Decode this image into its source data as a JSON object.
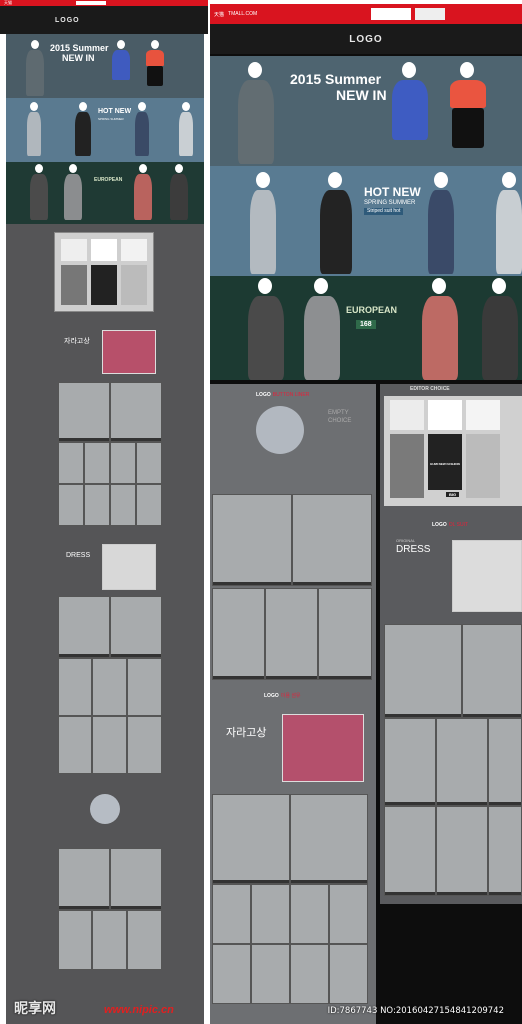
{
  "store": {
    "top_tmall": "天猫",
    "top_tmall_url": "TMALL.COM",
    "logo": "LOGO",
    "nav_items": [
      "",
      "",
      "",
      "",
      "",
      "",
      "",
      ""
    ]
  },
  "banners": {
    "summer_line1": "2015 Summer",
    "summer_line2": "NEW IN",
    "hot_line1": "HOT NEW",
    "hot_line2": "SPRING SUMMER",
    "hot_line3": "Striped suit hot",
    "europe_line1": "EUROPEAN",
    "europe_price": "168"
  },
  "sections": {
    "editor_choice": "EDITOR CHOICE",
    "gumi_new": "GUMI NEW FASHION",
    "big": "BIG",
    "button_liner": "BUTTON LINER",
    "empty_choice1": "EMPTY",
    "empty_choice2": "CHOICE",
    "section_logo": "LOGO",
    "korean_title": "자라고상",
    "korean_section": "이용 섬유",
    "ol_suit": "OL SUIT",
    "dress_original": "ORIGINAL",
    "dress_word": "DRESS"
  },
  "watermark": {
    "site": "昵享网",
    "url": "www.nipic.cn",
    "id_text": "ID:7867743 NO:20160427154841209742"
  },
  "colors": {
    "red": "#d9141f",
    "dark_gray": "#555555",
    "panel_gray": "#6d6f72",
    "cell_gray": "#a8abad"
  }
}
